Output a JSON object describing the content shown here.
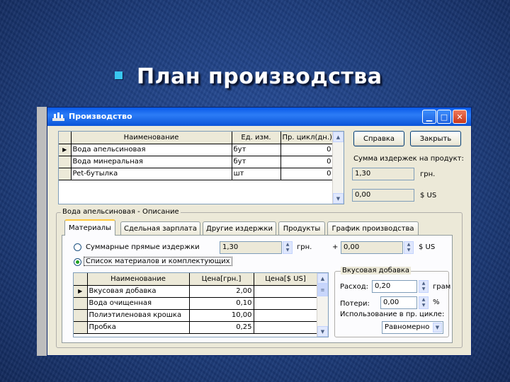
{
  "slide": {
    "title": "План производства"
  },
  "window": {
    "title": "Производство"
  },
  "products": {
    "columns": [
      "Наименование",
      "Ед. изм.",
      "Пр. цикл(дн.)"
    ],
    "rows": [
      {
        "name": "Вода апельсиновая",
        "unit": "бут",
        "cycle": "0"
      },
      {
        "name": "Вода минеральная",
        "unit": "бут",
        "cycle": "0"
      },
      {
        "name": "Pet-бутылка",
        "unit": "шт",
        "cycle": "0"
      }
    ]
  },
  "buttons": {
    "help": "Справка",
    "close": "Закрыть"
  },
  "summary": {
    "label": "Сумма издержек на продукт:",
    "uah_value": "1,30",
    "uah_unit": "грн.",
    "usd_value": "0,00",
    "usd_unit": "$ US"
  },
  "description": {
    "group_title": "Вода апельсиновая - Описание"
  },
  "tabs": [
    "Материалы",
    "Сдельная зарплата",
    "Другие издержки",
    "Продукты",
    "График производства"
  ],
  "materials": {
    "radio_total": "Суммарные прямые издержки",
    "total_uah": "1,30",
    "total_uah_unit": "грн.",
    "plus": "+",
    "total_usd": "0,00",
    "total_usd_unit": "$ US",
    "radio_list": "Список материалов и комплектующих",
    "columns": [
      "Наименование",
      "Цена[грн.]",
      "Цена[$ US]"
    ],
    "rows": [
      {
        "name": "Вкусовая добавка",
        "uah": "2,00",
        "usd": ""
      },
      {
        "name": "Вода очищенная",
        "uah": "0,10",
        "usd": ""
      },
      {
        "name": "Полиэтиленовая крошка",
        "uah": "10,00",
        "usd": ""
      },
      {
        "name": "Пробка",
        "uah": "0,25",
        "usd": ""
      }
    ]
  },
  "additive": {
    "group_title": "Вкусовая добавка",
    "consumption_label": "Расход:",
    "consumption_value": "0,20",
    "consumption_unit": "грам",
    "loss_label": "Потери:",
    "loss_value": "0,00",
    "loss_unit": "%",
    "usage_label": "Использование в пр. цикле:",
    "usage_value": "Равномерно"
  }
}
